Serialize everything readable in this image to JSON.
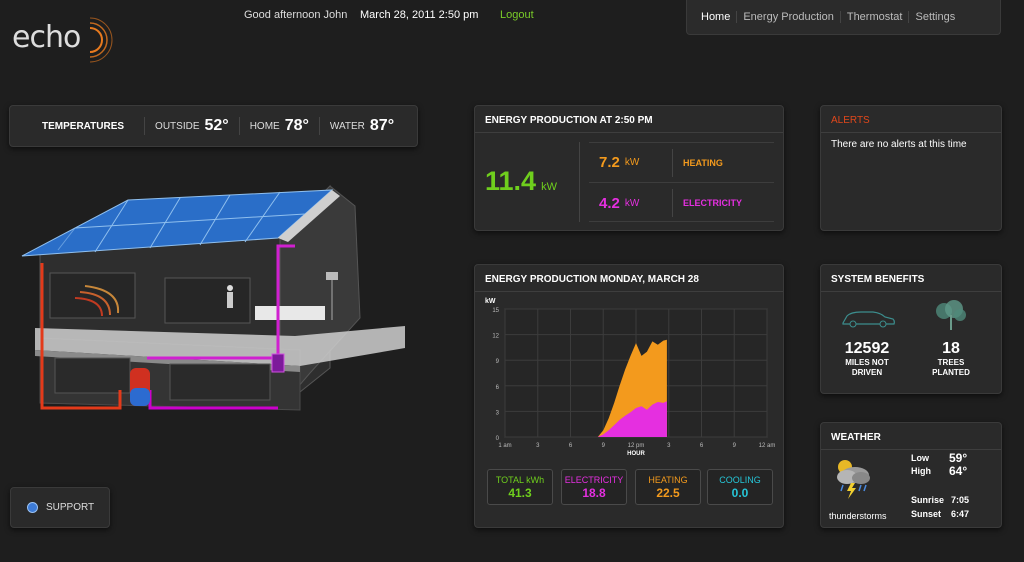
{
  "logo": {
    "text": "echo"
  },
  "header": {
    "greeting": "Good afternoon John",
    "datetime": "March 28, 2011 2:50 pm",
    "logout": "Logout"
  },
  "nav": [
    {
      "label": "Home",
      "active": true
    },
    {
      "label": "Energy Production",
      "active": false
    },
    {
      "label": "Thermostat",
      "active": false
    },
    {
      "label": "Settings",
      "active": false
    }
  ],
  "temperatures": {
    "title": "TEMPERATURES",
    "outside_label": "OUTSIDE",
    "outside": "52°",
    "home_label": "HOME",
    "home": "78°",
    "water_label": "WATER",
    "water": "87°"
  },
  "support": {
    "label": "SUPPORT"
  },
  "energy_now": {
    "title": "ENERGY PRODUCTION AT 2:50 PM",
    "total": "11.4",
    "total_unit": "kW",
    "heating_value": "7.2",
    "heating_unit": "kW",
    "heating_label": "HEATING",
    "electricity_value": "4.2",
    "electricity_unit": "kW",
    "electricity_label": "ELECTRICITY"
  },
  "energy_day": {
    "title": "ENERGY PRODUCTION MONDAY, MARCH 28",
    "totals": [
      {
        "label": "TOTAL kWh",
        "value": "41.3",
        "color": "#6fcf1d"
      },
      {
        "label": "ELECTRICITY",
        "value": "18.8",
        "color": "#e52fe0"
      },
      {
        "label": "HEATING",
        "value": "22.5",
        "color": "#f39a1d"
      },
      {
        "label": "COOLING",
        "value": "0.0",
        "color": "#26c6d8"
      }
    ]
  },
  "chart_data": {
    "type": "area",
    "ylabel": "kW",
    "xlabel": "HOUR",
    "ylim": [
      0,
      15
    ],
    "yticks": [
      "15",
      "12",
      "9",
      "6",
      "3",
      "0"
    ],
    "xticks": [
      "1 am",
      "3",
      "6",
      "9",
      "12 pm",
      "3",
      "6",
      "9",
      "12 am"
    ],
    "x": [
      8.5,
      9,
      9.5,
      10,
      10.5,
      11,
      11.5,
      12,
      12.5,
      13,
      13.5,
      14,
      14.5,
      14.83
    ],
    "series": [
      {
        "name": "ELECTRICITY",
        "color": "#e52fe0",
        "values": [
          0,
          0.3,
          0.8,
          1.4,
          2.0,
          2.5,
          2.9,
          3.4,
          3.6,
          3.2,
          3.8,
          4.1,
          4.0,
          4.2
        ]
      },
      {
        "name": "HEATING",
        "color": "#f39a1d",
        "values": [
          0,
          0.5,
          1.4,
          2.6,
          4.0,
          5.4,
          6.6,
          7.6,
          5.9,
          6.8,
          7.4,
          6.7,
          7.3,
          7.2
        ]
      }
    ],
    "grid": true
  },
  "alerts": {
    "title": "ALERTS",
    "message": "There are no alerts at this time"
  },
  "benefits": {
    "title": "SYSTEM BENEFITS",
    "miles": "12592",
    "miles_label_1": "MILES NOT",
    "miles_label_2": "DRIVEN",
    "trees": "18",
    "trees_label_1": "TREES",
    "trees_label_2": "PLANTED",
    "car_icon": "car-icon",
    "tree_icon": "tree-icon"
  },
  "weather": {
    "title": "WEATHER",
    "icon": "thunderstorm-icon",
    "condition": "thunderstorms",
    "low_label": "Low",
    "low": "59°",
    "high_label": "High",
    "high": "64°",
    "sunrise_label": "Sunrise",
    "sunrise": "7:05",
    "sunset_label": "Sunset",
    "sunset": "6:47"
  }
}
